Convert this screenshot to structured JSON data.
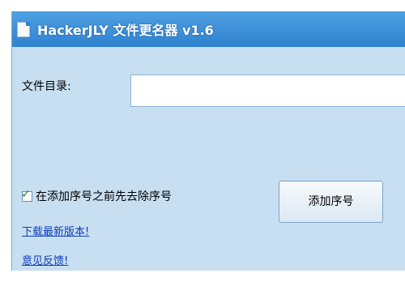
{
  "window": {
    "title": "HackerJLY 文件更名器 v1.6"
  },
  "form": {
    "dir_label": "文件目录:",
    "dir_value": "",
    "checkbox_label": "在添加序号之前先去除序号",
    "checkbox_checked": true,
    "add_button_label": "添加序号"
  },
  "links": {
    "download": "下载最新版本!",
    "feedback": "意见反馈!"
  },
  "icons": {
    "app": "document-icon",
    "check": "checkmark-icon"
  },
  "colors": {
    "titlebar": "#2f82cf",
    "client_bg": "#c8dff2",
    "link": "#0b3db8"
  }
}
